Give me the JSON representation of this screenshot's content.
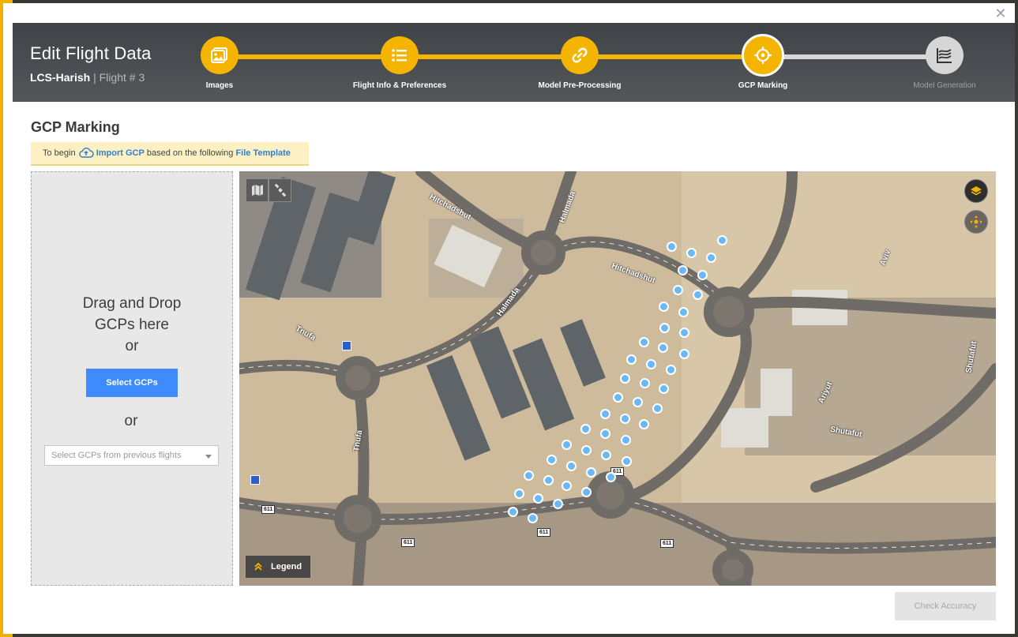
{
  "modal": {
    "title": "Edit Flight Data",
    "project": "LCS-Harish",
    "flight": "| Flight # 3",
    "close_icon": "close-icon"
  },
  "steps": [
    {
      "label": "Images",
      "icon": "images-icon",
      "state": "done"
    },
    {
      "label": "Flight Info & Preferences",
      "icon": "list-icon",
      "state": "done"
    },
    {
      "label": "Model Pre-Processing",
      "icon": "link-icon",
      "state": "done"
    },
    {
      "label": "GCP Marking",
      "icon": "crosshair-icon",
      "state": "active"
    },
    {
      "label": "Model Generation",
      "icon": "layers-chart-icon",
      "state": "pending"
    }
  ],
  "section": {
    "title": "GCP Marking",
    "info_prefix": "To begin",
    "import_link": "Import GCP",
    "info_middle": "based on the following",
    "template_link": "File Template"
  },
  "dropzone": {
    "line1": "Drag and Drop",
    "line2": "GCPs here",
    "or1": "or",
    "select_button": "Select GCPs",
    "or2": "or",
    "previous_placeholder": "Select GCPs from previous flights"
  },
  "map": {
    "legend": "Legend",
    "labels": [
      "Hitchadshut",
      "Halmada",
      "Hitchadshut",
      "Halmada",
      "Tnufa",
      "Tnufa",
      "Aviv",
      "Shutafut",
      "Shutafut",
      "Ariyut"
    ],
    "road_numbers": [
      "611",
      "611",
      "611",
      "611",
      "611"
    ]
  },
  "footer": {
    "check_button": "Check Accuracy"
  },
  "colors": {
    "accent": "#f4b400",
    "primary_button": "#3d8bfd",
    "gcp_marker": "#6ab8f6",
    "header_bg": "#3f4347"
  }
}
